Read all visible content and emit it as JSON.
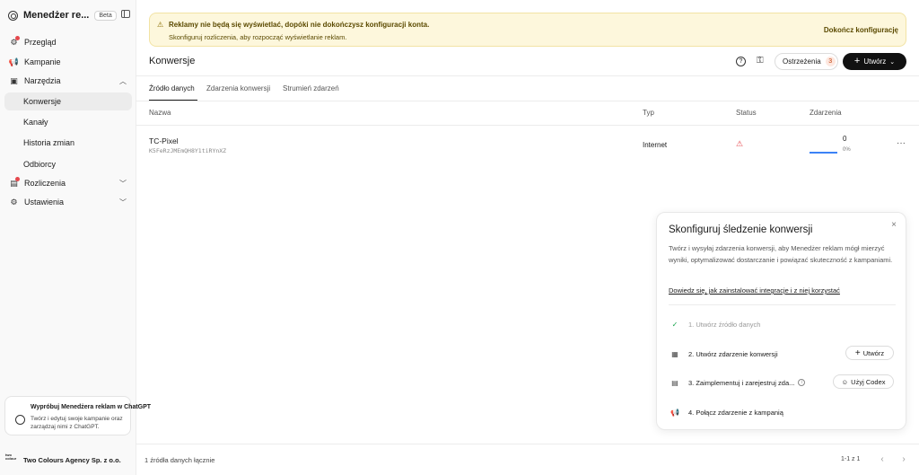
{
  "app": {
    "title": "Menedżer re...",
    "badge": "Beta"
  },
  "sidebar": {
    "items": [
      {
        "label": "Przegląd",
        "icon": "overview-icon"
      },
      {
        "label": "Kampanie",
        "icon": "megaphone-icon"
      },
      {
        "label": "Narzędzia",
        "icon": "tools-icon"
      },
      {
        "label": "Konwersje"
      },
      {
        "label": "Kanały"
      },
      {
        "label": "Historia zmian"
      },
      {
        "label": "Odbiorcy"
      },
      {
        "label": "Rozliczenia",
        "icon": "billing-icon"
      },
      {
        "label": "Ustawienia",
        "icon": "gear-icon"
      }
    ],
    "promo": {
      "title": "Wypróbuj Menedżera reklam w ChatGPT",
      "text": "Twórz i edytuj swoje kampanie oraz zarządzaj nimi z ChatGPT."
    },
    "org": {
      "name": "Two Colours Agency Sp. z o.o.",
      "logo_text": "two colour"
    }
  },
  "banner": {
    "title": "Reklamy nie będą się wyświetlać, dopóki nie dokończysz konfiguracji konta.",
    "text": "Skonfiguruj rozliczenia, aby rozpocząć wyświetlanie reklam.",
    "link": "Dokończ konfigurację"
  },
  "header": {
    "title": "Konwersje",
    "warnings_label": "Ostrzeżenia",
    "warnings_count": "3",
    "create_label": "Utwórz"
  },
  "tabs": [
    "Źródło danych",
    "Zdarzenia konwersji",
    "Strumień zdarzeń"
  ],
  "table": {
    "columns": [
      "Nazwa",
      "Typ",
      "Status",
      "Zdarzenia"
    ],
    "rows": [
      {
        "name": "TC-Pixel",
        "id": "K5FeRzJMEmQH8Y1tiRYnXZ",
        "type": "Internet",
        "events": "0",
        "pct": "0%",
        "fill": 1.0
      }
    ]
  },
  "panel": {
    "title": "Skonfiguruj śledzenie konwersji",
    "description": "Twórz i wysyłaj zdarzenia konwersji, aby Menedżer reklam mógł mierzyć wyniki, optymalizować dostarczanie i powiązać skuteczność z kampaniami.",
    "link": "Dowiedz się, jak zainstalować integracje i z niej korzystać",
    "steps": [
      {
        "label": "1. Utwórz źródło danych"
      },
      {
        "label": "2. Utwórz zdarzenie konwersji",
        "button": "Utwórz"
      },
      {
        "label": "3. Zaimplementuj i zarejestruj zda...",
        "button": "Użyj Codex"
      },
      {
        "label": "4. Połącz zdarzenie z kampanią"
      }
    ]
  },
  "footer": {
    "summary": "1 źródła danych łącznie",
    "pager": "1-1 z 1"
  },
  "colors": {
    "accent": "#111111",
    "warning_bg": "#fdf7dc",
    "status_warning": "#e5484d",
    "progress": "#3b82f6"
  }
}
